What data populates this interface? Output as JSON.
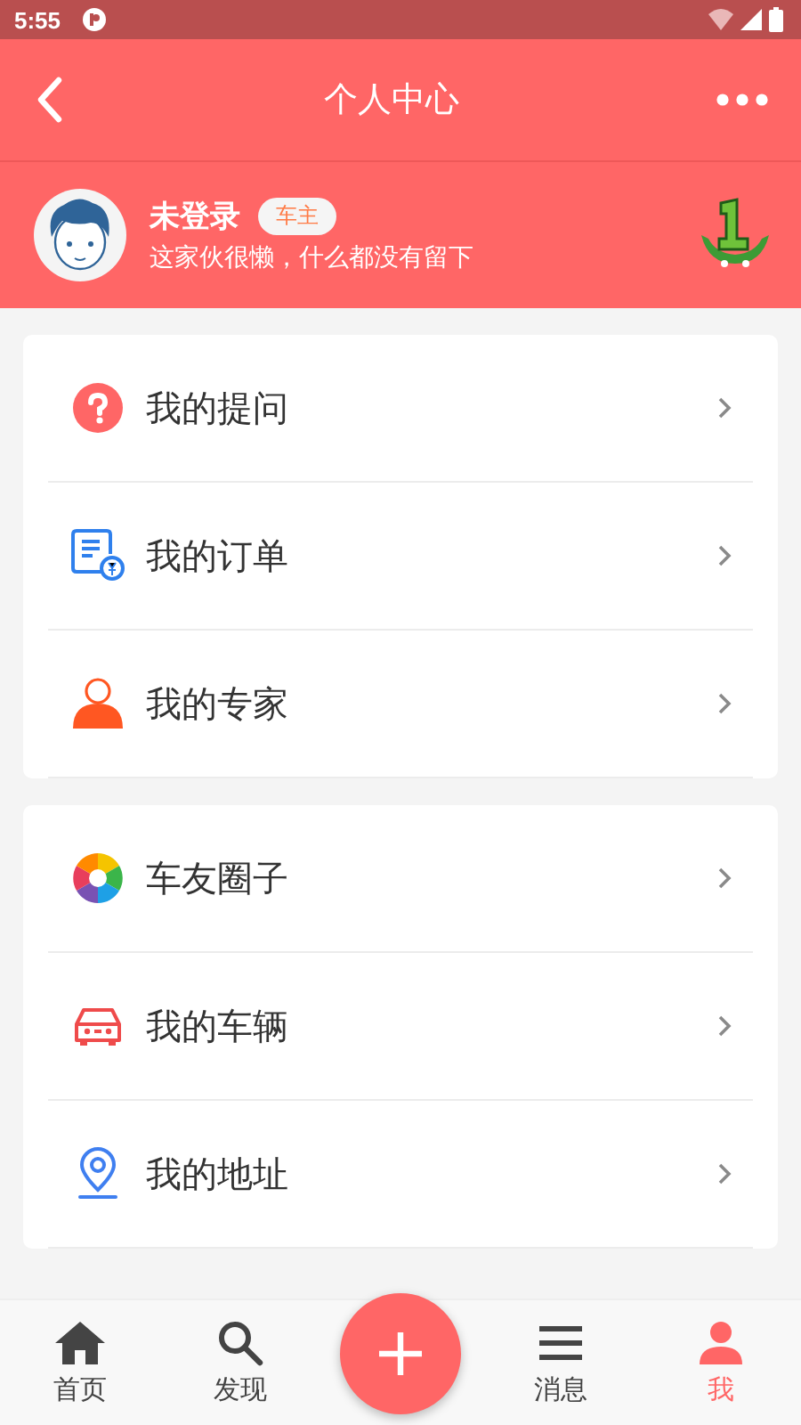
{
  "status_bar": {
    "time": "5:55"
  },
  "header": {
    "title": "个人中心"
  },
  "profile": {
    "name": "未登录",
    "badge": "车主",
    "bio": "这家伙很懒，什么都没有留下"
  },
  "menu_groups": [
    [
      {
        "label": "我的提问"
      },
      {
        "label": "我的订单"
      },
      {
        "label": "我的专家"
      }
    ],
    [
      {
        "label": "车友圈子"
      },
      {
        "label": "我的车辆"
      },
      {
        "label": "我的地址"
      }
    ]
  ],
  "bottom_nav": [
    {
      "label": "首页",
      "selected": false
    },
    {
      "label": "发现",
      "selected": false
    },
    {
      "label": "消息",
      "selected": false
    },
    {
      "label": "我",
      "selected": true
    }
  ]
}
